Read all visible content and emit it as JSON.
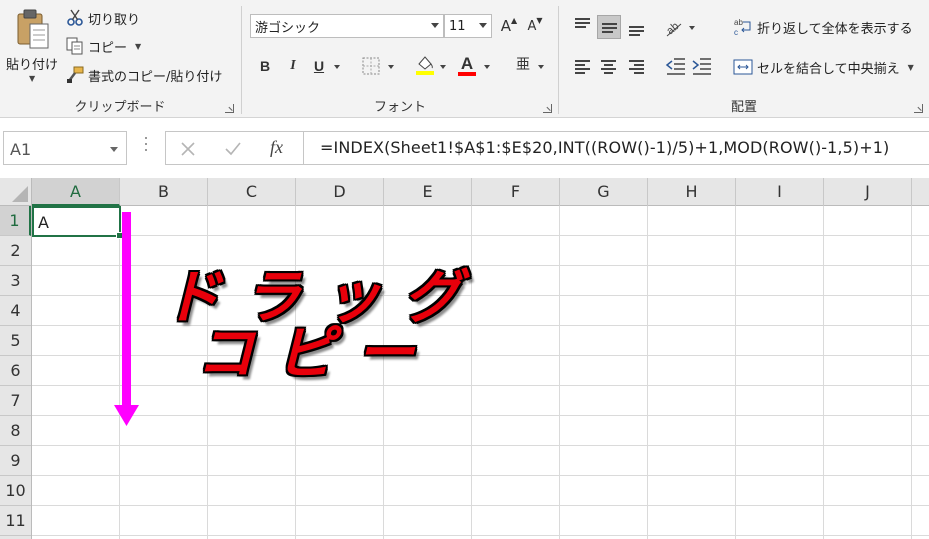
{
  "ribbon": {
    "clipboard": {
      "paste_label": "貼り付け",
      "cut_label": "切り取り",
      "copy_label": "コピー",
      "format_painter_label": "書式のコピー/貼り付け",
      "group_label": "クリップボード"
    },
    "font": {
      "font_name": "游ゴシック",
      "font_size": "11",
      "grow_label": "A",
      "shrink_label": "A",
      "bold_label": "B",
      "italic_label": "I",
      "underline_label": "U",
      "font_color_label": "A",
      "phonetic_label": "亜",
      "group_label": "フォント",
      "highlight_color": "#ffff00",
      "font_color": "#ff0000"
    },
    "alignment": {
      "wrap_text_label": "折り返して全体を表示する",
      "merge_center_label": "セルを結合して中央揃え",
      "group_label": "配置"
    }
  },
  "formula_bar": {
    "name_box": "A1",
    "fx_label": "fx",
    "formula": "=INDEX(Sheet1!$A$1:$E$20,INT((ROW()-1)/5)+1,MOD(ROW()-1,5)+1)"
  },
  "sheet": {
    "columns": [
      "A",
      "B",
      "C",
      "D",
      "E",
      "F",
      "G",
      "H",
      "I",
      "J"
    ],
    "rows": [
      "1",
      "2",
      "3",
      "4",
      "5",
      "6",
      "7",
      "8",
      "9",
      "10",
      "11"
    ],
    "selected_column": "A",
    "selected_row": "1",
    "cell_a1": "A",
    "accent_color": "#217346"
  },
  "annotation": {
    "line1": "ドラッグ",
    "line2": "コピー",
    "text_color": "#e8000b",
    "arrow_color": "#ff00ff"
  }
}
